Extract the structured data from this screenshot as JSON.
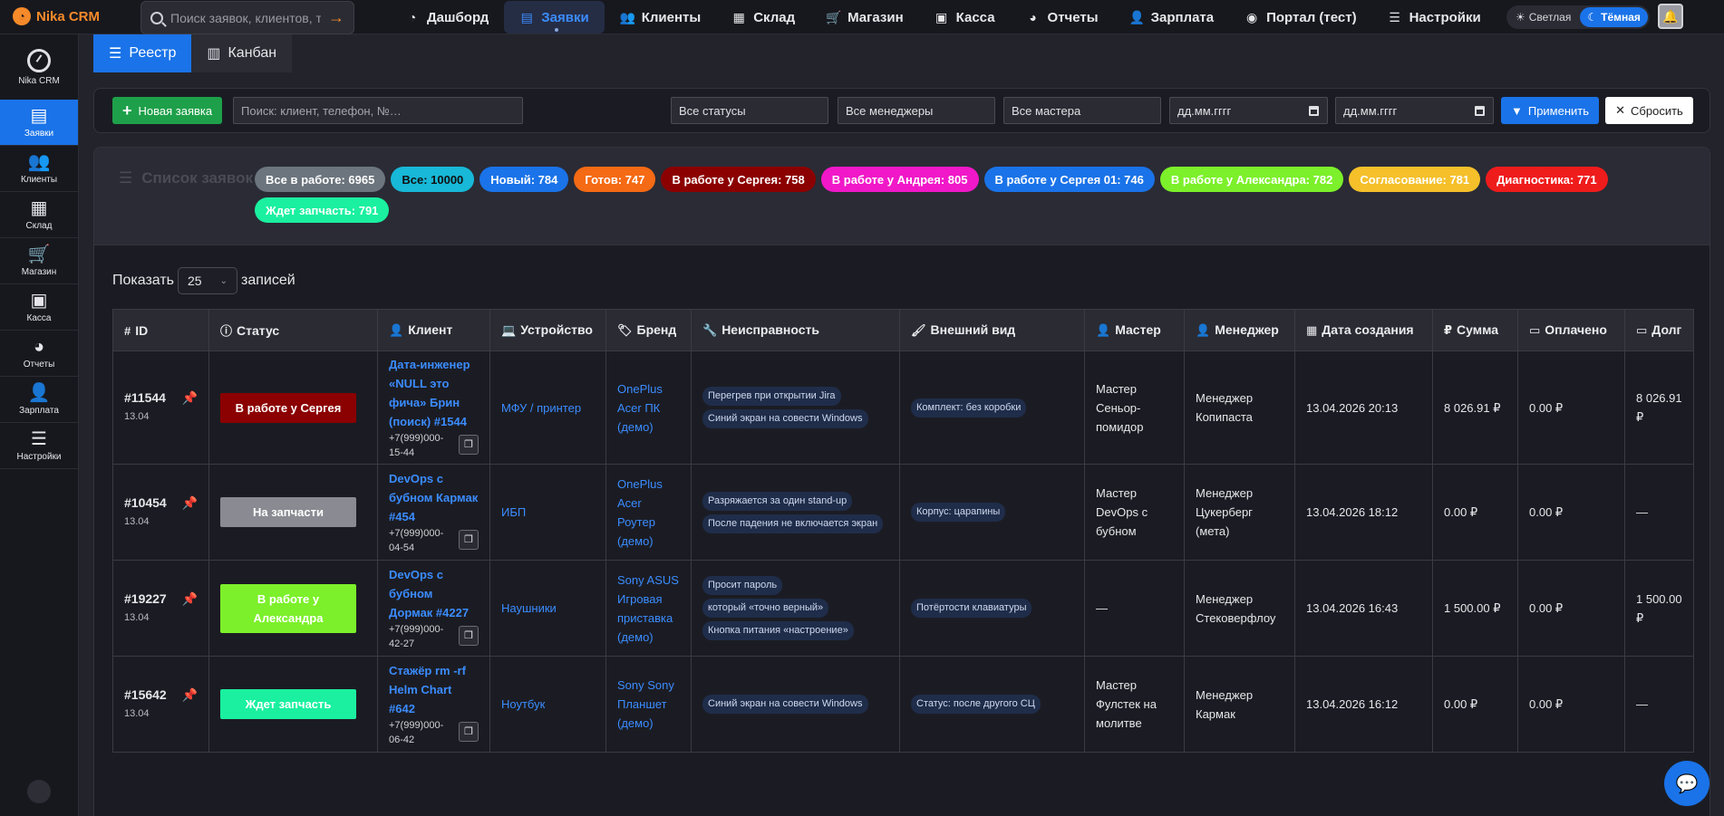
{
  "app": {
    "logo": "Nika CRM"
  },
  "top_search": {
    "placeholder": "Поиск заявок, клиентов, т..."
  },
  "nav": [
    {
      "label": "Дашборд",
      "icon": "dashboard-icon"
    },
    {
      "label": "Заявки",
      "icon": "file-icon",
      "active": true
    },
    {
      "label": "Клиенты",
      "icon": "users-icon"
    },
    {
      "label": "Склад",
      "icon": "boxes-icon"
    },
    {
      "label": "Магазин",
      "icon": "cart-icon"
    },
    {
      "label": "Касса",
      "icon": "cash-register-icon"
    },
    {
      "label": "Отчеты",
      "icon": "pie-chart-icon"
    },
    {
      "label": "Зарплата",
      "icon": "user-icon"
    },
    {
      "label": "Портал (тест)",
      "icon": "user-circle-icon"
    },
    {
      "label": "Настройки",
      "icon": "sliders-icon"
    }
  ],
  "theme": {
    "light": "Светлая",
    "dark": "Тёмная"
  },
  "sidebar": {
    "logo": "Nika CRM",
    "items": [
      {
        "label": "Заявки",
        "active": true
      },
      {
        "label": "Клиенты"
      },
      {
        "label": "Склад"
      },
      {
        "label": "Магазин"
      },
      {
        "label": "Касса"
      },
      {
        "label": "Отчеты"
      },
      {
        "label": "Зарплата"
      },
      {
        "label": "Настройки"
      }
    ]
  },
  "tabs": [
    {
      "label": "Реестр",
      "active": true
    },
    {
      "label": "Канбан"
    }
  ],
  "filters": {
    "new_label": "Новая заявка",
    "search_placeholder": "Поиск: клиент, телефон, №…",
    "status": "Все статусы",
    "manager": "Все менеджеры",
    "master": "Все мастера",
    "date_from": "дд.мм.гггг",
    "date_to": "дд.мм.гггг",
    "apply_label": "Применить",
    "reset_label": "Сбросить"
  },
  "list_title": "Список заявок",
  "badges": [
    {
      "label": "Все в работе: 6965",
      "color": "#6c757d"
    },
    {
      "label": "Все: 10000",
      "color": "#17b8d8",
      "text": "#111"
    },
    {
      "label": "Новый: 784",
      "color": "#1a73e8"
    },
    {
      "label": "Готов: 747",
      "color": "#f56a14"
    },
    {
      "label": "В работе у Сергея: 758",
      "color": "#8b0000"
    },
    {
      "label": "В работе у Андрея: 805",
      "color": "#f018c8"
    },
    {
      "label": "В работе у Сергея 01: 746",
      "color": "#1a73e8"
    },
    {
      "label": "В работе у Александра: 782",
      "color": "#7cf02a"
    },
    {
      "label": "Согласование: 781",
      "color": "#f5c02a"
    },
    {
      "label": "Диагностика: 771",
      "color": "#ef1c1c"
    },
    {
      "label": "Ждет запчасть: 791",
      "color": "#1af0a0"
    }
  ],
  "show": {
    "prefix": "Показать",
    "value": "25",
    "suffix": "записей"
  },
  "columns": [
    "ID",
    "Статус",
    "Клиент",
    "Устройство",
    "Бренд",
    "Неисправность",
    "Внешний вид",
    "Мастер",
    "Менеджер",
    "Дата создания",
    "Сумма",
    "Оплачено",
    "Долг"
  ],
  "rows": [
    {
      "id": "#11544",
      "date_short": "13.04",
      "pinned": true,
      "status": "В работе у Сергея",
      "status_color": "#8b0000",
      "client": "Дата-инженер «NULL это фича» Брин (поиск) #1544",
      "phone": "+7(999)000-15-44",
      "device": "МФУ / принтер",
      "brand": "OnePlus Acer ПК (демо)",
      "issues": [
        "Перегрев при открытии Jira",
        "Синий экран на совести Windows"
      ],
      "look": "Комплект: без коробки",
      "master": "Мастер Сеньор-помидор",
      "manager": "Менеджер Копипаста",
      "created": "13.04.2026 20:13",
      "sum": "8 026.91 ₽",
      "paid": "0.00 ₽",
      "debt": "8 026.91 ₽"
    },
    {
      "id": "#10454",
      "date_short": "13.04",
      "pinned": false,
      "status": "На запчасти",
      "status_color": "#8a8b92",
      "client": "DevOps с бубном Кармак #454",
      "phone": "+7(999)000-04-54",
      "device": "ИБП",
      "brand": "OnePlus Acer Роутер (демо)",
      "issues": [
        "Разряжается за один stand-up",
        "После падения не включается экран"
      ],
      "look": "Корпус: царапины",
      "master": "Мастер DevOps с бубном",
      "manager": "Менеджер Цукерберг (мета)",
      "created": "13.04.2026 18:12",
      "sum": "0.00 ₽",
      "paid": "0.00 ₽",
      "debt": "—"
    },
    {
      "id": "#19227",
      "date_short": "13.04",
      "pinned": false,
      "status": "В работе у Александра",
      "status_color": "#7cf02a",
      "client": "DevOps с бубном Дормак #4227",
      "phone": "+7(999)000-42-27",
      "device": "Наушники",
      "brand": "Sony ASUS Игровая приставка (демо)",
      "issues": [
        "Просит пароль",
        "который «точно верный»",
        "Кнопка питания «настроение»"
      ],
      "look": "Потёртости клавиатуры",
      "master": "—",
      "manager": "Менеджер Стековерфлоу",
      "created": "13.04.2026 16:43",
      "sum": "1 500.00 ₽",
      "paid": "0.00 ₽",
      "debt": "1 500.00 ₽"
    },
    {
      "id": "#15642",
      "date_short": "13.04",
      "pinned": false,
      "status": "Ждет запчасть",
      "status_color": "#1af0a0",
      "client": "Стажёр rm -rf Helm Chart #642",
      "phone": "+7(999)000-06-42",
      "device": "Ноутбук",
      "brand": "Sony Sony Планшет (демо)",
      "issues": [
        "Синий экран на совести Windows"
      ],
      "look": "Статус: после другого СЦ",
      "master": "Мастер Фулстек на молитве",
      "manager": "Менеджер Кармак",
      "created": "13.04.2026 16:12",
      "sum": "0.00 ₽",
      "paid": "0.00 ₽",
      "debt": "—"
    }
  ]
}
